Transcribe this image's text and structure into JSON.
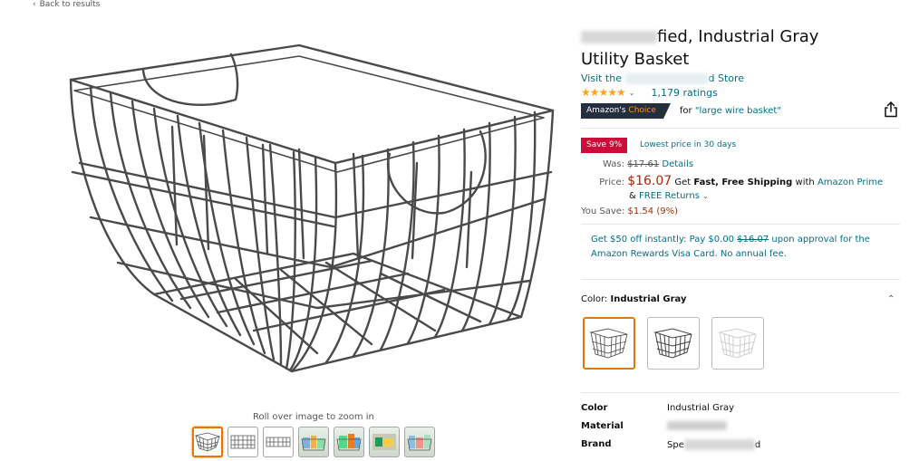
{
  "nav": {
    "back_label": "Back to results"
  },
  "gallery": {
    "zoom_hint": "Roll over image to zoom in",
    "thumbnail_count": 7
  },
  "product": {
    "title_visible": "fied, Industrial Gray Utility Basket",
    "title_line1_end": "fied, Industrial Gray",
    "title_line2": "Utility Basket",
    "store_prefix": "Visit the",
    "store_suffix": "d Store",
    "rating_stars": "★★★★★",
    "ratings_count": "1,179 ratings"
  },
  "badge": {
    "choice_part1": "Amazon's",
    "choice_part2": "Choice",
    "for_label": "for",
    "keyword": "\"large wire basket\""
  },
  "deal": {
    "save_label": "Save 9%",
    "lowest_label": "Lowest price in 30 days"
  },
  "pricing": {
    "was_label": "Was:",
    "was_price": "$17.61",
    "details_link": "Details",
    "price_label": "Price:",
    "price": "$16.07",
    "shipping_pre": "Get",
    "shipping_bold": "Fast, Free Shipping",
    "shipping_with": "with",
    "prime_link": "Amazon Prime",
    "returns_amp": "&",
    "returns_link": "FREE Returns",
    "you_save_label": "You Save:",
    "you_save_value": "$1.54 (9%)"
  },
  "promo": {
    "text_pre": "Get $50 off instantly: Pay $0.00",
    "strike_price": "$16.07",
    "text_post": "upon approval for the Amazon Rewards Visa Card. No annual fee."
  },
  "color": {
    "label": "Color:",
    "selected": "Industrial Gray"
  },
  "specs": [
    {
      "key": "Color",
      "value": "Industrial Gray"
    },
    {
      "key": "Material",
      "value": ""
    },
    {
      "key": "Brand",
      "value": "Spe"
    }
  ],
  "colors": {
    "link": "#007185",
    "price": "#B12704",
    "star": "#FFA41C",
    "save_badge": "#CC0C39",
    "choice_badge": "#232f3e",
    "selected_border": "#e77600"
  },
  "icons": [
    "share-icon",
    "chevron-down-icon",
    "chevron-up-icon",
    "chevron-left-icon"
  ]
}
